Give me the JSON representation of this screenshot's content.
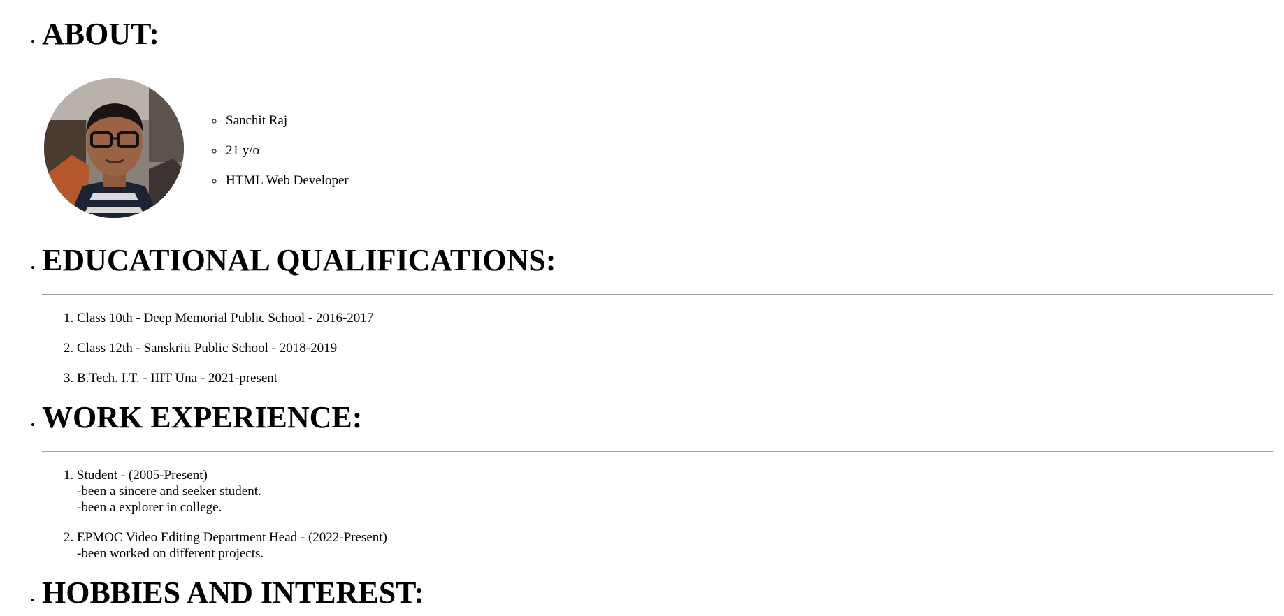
{
  "about": {
    "title": "ABOUT:",
    "avatar_alt": "profile photo",
    "details": [
      "Sanchit Raj",
      "21 y/o",
      "HTML Web Developer"
    ]
  },
  "education": {
    "title": "EDUCATIONAL QUALIFICATIONS:",
    "items": [
      "Class 10th - Deep Memorial Public School - 2016-2017",
      "Class 12th - Sanskriti Public School - 2018-2019",
      "B.Tech. I.T. - IIIT Una - 2021-present"
    ]
  },
  "work": {
    "title": "WORK EXPERIENCE:",
    "items": [
      {
        "heading": "Student - (2005-Present)",
        "lines": [
          "-been a sincere and seeker student.",
          "-been a explorer in college."
        ]
      },
      {
        "heading": "EPMOC Video Editing Department Head - (2022-Present)",
        "lines": [
          "-been worked on different projects."
        ]
      }
    ]
  },
  "hobbies": {
    "title": "HOBBIES AND INTEREST:"
  },
  "colors": {
    "text": "#000000",
    "rule": "#a0a0a0",
    "background": "#ffffff"
  }
}
